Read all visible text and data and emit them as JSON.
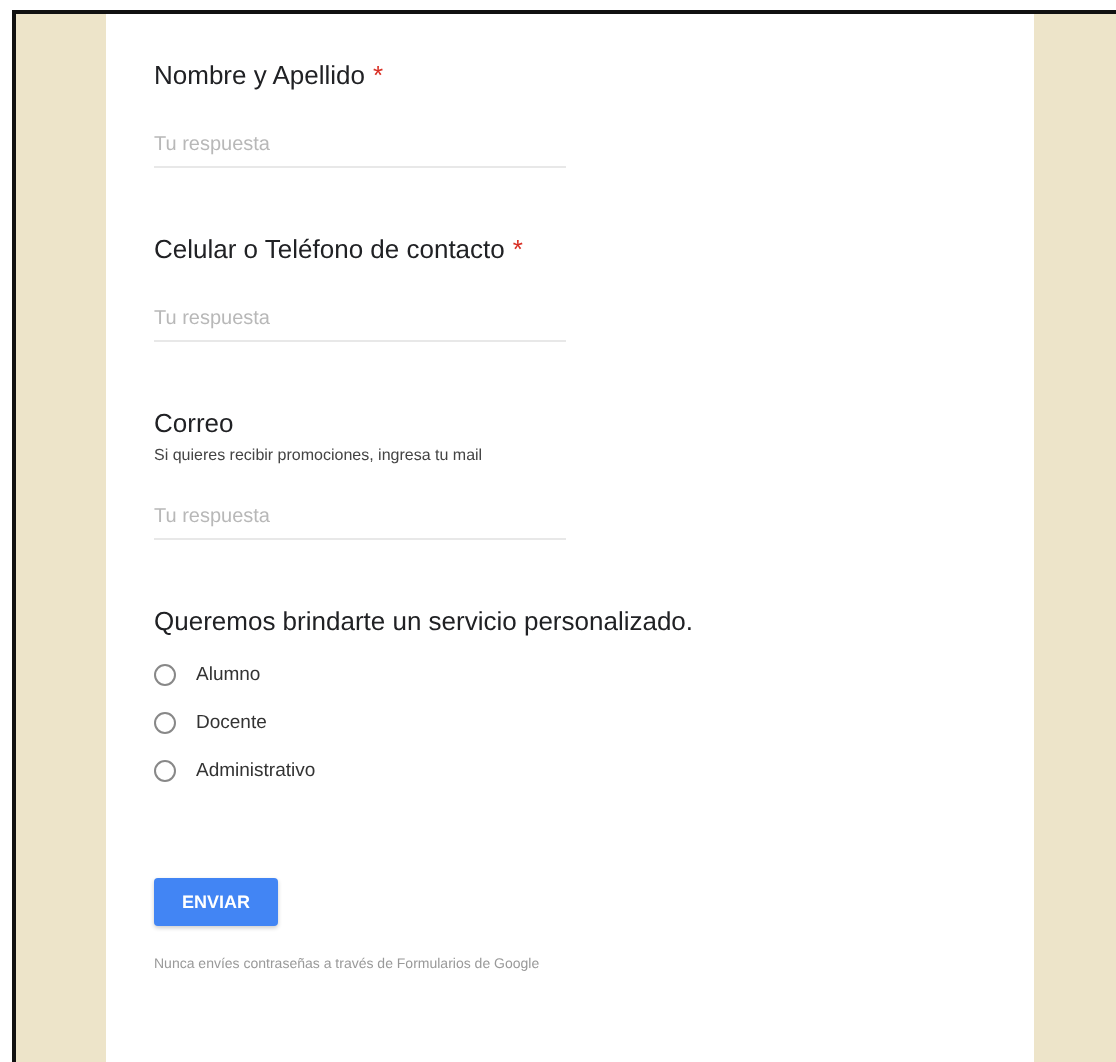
{
  "questions": [
    {
      "kind": "text",
      "title": "Nombre y Apellido",
      "required": true,
      "placeholder": "Tu respuesta"
    },
    {
      "kind": "text",
      "title": "Celular o Teléfono de contacto",
      "required": true,
      "placeholder": "Tu respuesta"
    },
    {
      "kind": "text",
      "title": "Correo",
      "required": false,
      "help": "Si quieres recibir promociones, ingresa tu mail",
      "placeholder": "Tu respuesta"
    },
    {
      "kind": "choice",
      "title": "Queremos brindarte un servicio personalizado.",
      "required": false,
      "options": [
        {
          "label": "Alumno",
          "selected": false
        },
        {
          "label": "Docente",
          "selected": false
        },
        {
          "label": "Administrativo",
          "selected": false
        }
      ]
    }
  ],
  "required_mark": "*",
  "submit": "ENVIAR",
  "footer": "Nunca envíes contraseñas a través de Formularios de Google"
}
